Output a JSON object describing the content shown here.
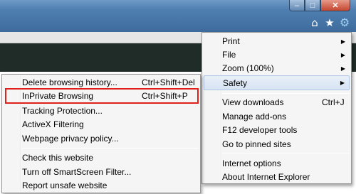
{
  "window_controls": {
    "minimize": "–",
    "maximize": "□",
    "close": "✕"
  },
  "toolbar_icons": [
    {
      "name": "home-icon",
      "glyph": "⌂"
    },
    {
      "name": "favorites-star-icon",
      "glyph": "★"
    },
    {
      "name": "tools-gear-icon",
      "glyph": "⚙"
    }
  ],
  "tools_menu": {
    "items": [
      {
        "label": "Print",
        "submenu": true
      },
      {
        "label": "File",
        "submenu": true
      },
      {
        "label": "Zoom (100%)",
        "submenu": true
      },
      {
        "label": "Safety",
        "submenu": true,
        "active": true
      },
      {
        "label": "View downloads",
        "shortcut": "Ctrl+J"
      },
      {
        "label": "Manage add-ons"
      },
      {
        "label": "F12 developer tools"
      },
      {
        "label": "Go to pinned sites"
      },
      {
        "label": "Internet options"
      },
      {
        "label": "About Internet Explorer"
      }
    ],
    "arrow_glyph": "▶"
  },
  "safety_submenu": {
    "items": [
      {
        "label": "Delete browsing history...",
        "shortcut": "Ctrl+Shift+Del"
      },
      {
        "label": "InPrivate Browsing",
        "shortcut": "Ctrl+Shift+P",
        "highlighted": true
      },
      {
        "label": "Tracking Protection..."
      },
      {
        "label": "ActiveX Filtering"
      },
      {
        "label": "Webpage privacy policy..."
      },
      {
        "label": "Check this website"
      },
      {
        "label": "Turn off SmartScreen Filter..."
      },
      {
        "label": "Report unsafe website"
      }
    ]
  },
  "colors": {
    "highlight_border": "#e0201b",
    "menu_bg": "#f5f5f5",
    "frame": "#4f7fb1"
  }
}
